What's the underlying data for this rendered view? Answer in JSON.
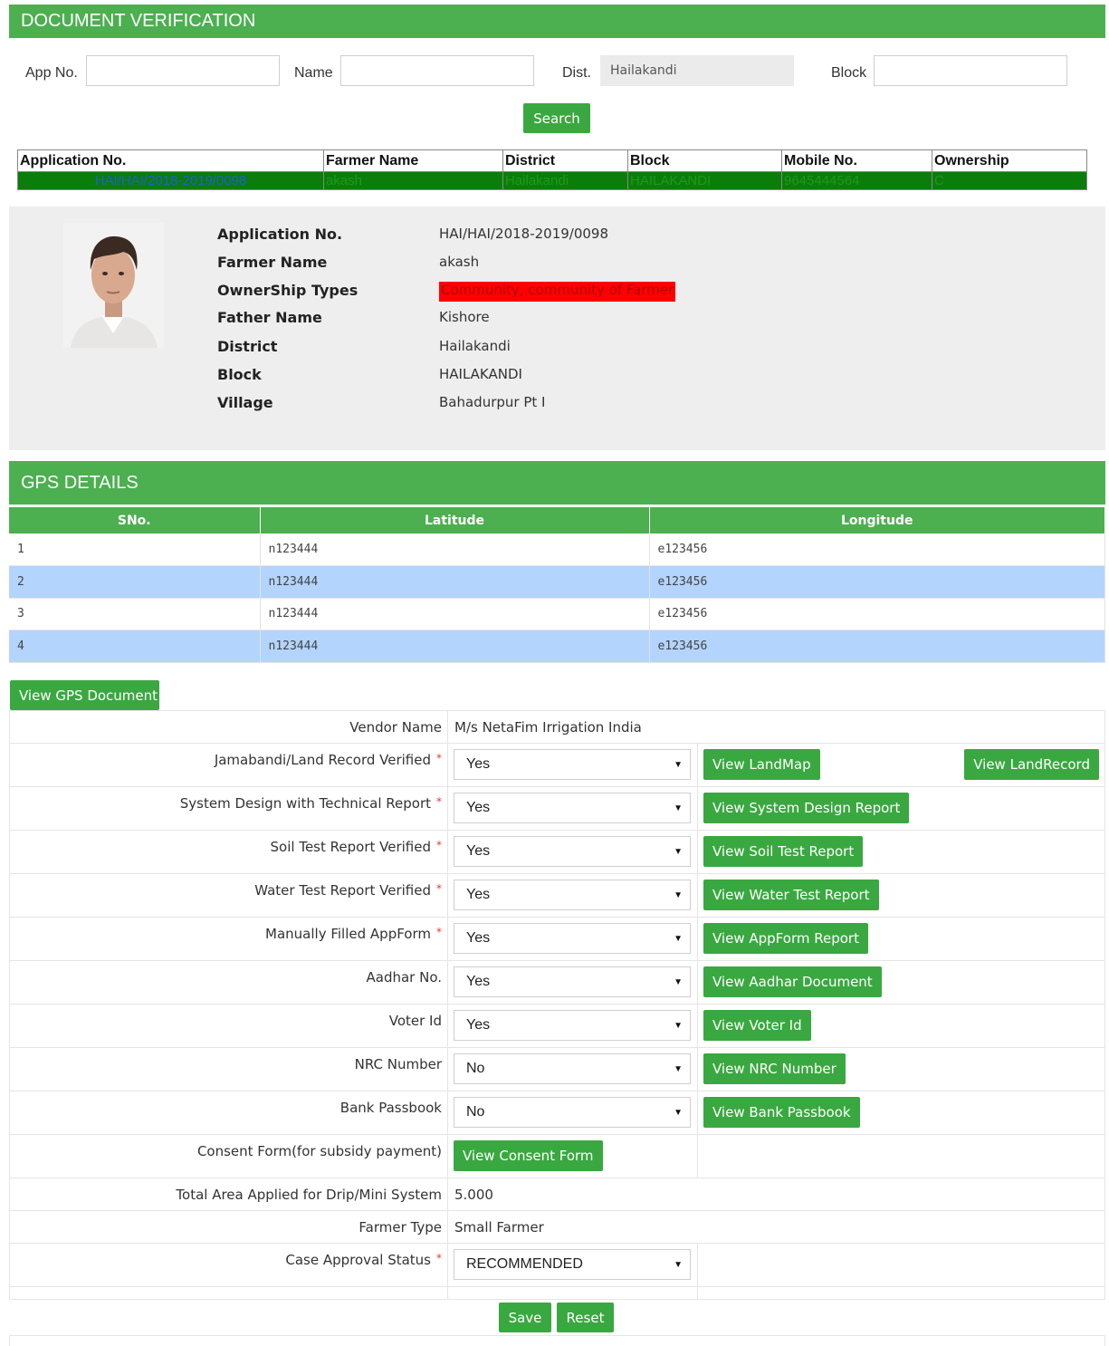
{
  "header": {
    "title": "DOCUMENT VERIFICATION"
  },
  "search": {
    "app_no_label": "App No.",
    "app_no_value": "",
    "name_label": "Name",
    "name_value": "",
    "dist_label": "Dist.",
    "dist_value": "Hailakandi",
    "block_label": "Block",
    "block_value": "",
    "search_button": "Search"
  },
  "results": {
    "headers": [
      "Application No.",
      "Farmer Name",
      "District",
      "Block",
      "Mobile No.",
      "Ownership"
    ],
    "rows": [
      [
        "HAI/HAI/2018-2019/0098",
        "akash",
        "Hailakandi",
        "HAILAKANDI",
        "9645444564",
        "C"
      ]
    ]
  },
  "profile": {
    "labels": {
      "application_no": "Application No.",
      "farmer_name": "Farmer Name",
      "ownership": "OwnerShip Types",
      "father_name": "Father Name",
      "district": "District",
      "block": "Block",
      "village": "Village"
    },
    "values": {
      "application_no": "HAI/HAI/2018-2019/0098",
      "farmer_name": "akash",
      "ownership": "Community, community of Farmer",
      "father_name": "Kishore",
      "district": "Hailakandi",
      "block": "HAILAKANDI",
      "village": "Bahadurpur Pt I"
    }
  },
  "gps": {
    "title": "GPS DETAILS",
    "headers": [
      "SNo.",
      "Latitude",
      "Longitude"
    ],
    "rows": [
      [
        "1",
        "n123444",
        "e123456"
      ],
      [
        "2",
        "n123444",
        "e123456"
      ],
      [
        "3",
        "n123444",
        "e123456"
      ],
      [
        "4",
        "n123444",
        "e123456"
      ]
    ],
    "view_button": "View GPS Document"
  },
  "form": {
    "vendor_label": "Vendor Name",
    "vendor_value": "M/s NetaFim Irrigation India",
    "jamabandi_label": "Jamabandi/Land Record Verified",
    "jamabandi_value": "Yes",
    "view_landmap": "View LandMap",
    "view_landrecord": "View LandRecord",
    "system_label": "System Design with Technical Report",
    "system_value": "Yes",
    "view_system": "View System Design Report",
    "soil_label": "Soil Test Report Verified",
    "soil_value": "Yes",
    "view_soil": "View Soil Test Report",
    "water_label": "Water Test Report Verified",
    "water_value": "Yes",
    "view_water": "View Water Test Report",
    "appform_label": "Manually Filled AppForm",
    "appform_value": "Yes",
    "view_appform": "View AppForm Report",
    "aadhar_label": "Aadhar No.",
    "aadhar_value": "Yes",
    "view_aadhar": "View Aadhar Document",
    "voter_label": "Voter Id",
    "voter_value": "Yes",
    "view_voter": "View Voter Id",
    "nrc_label": "NRC Number",
    "nrc_value": "No",
    "view_nrc": "View NRC Number",
    "bank_label": "Bank Passbook",
    "bank_value": "No",
    "view_bank": "View Bank Passbook",
    "consent_label": "Consent Form(for subsidy payment)",
    "view_consent": "View Consent Form",
    "area_label": "Total Area Applied for Drip/Mini System",
    "area_value": "5.000",
    "farmer_type_label": "Farmer Type",
    "farmer_type_value": "Small Farmer",
    "case_label": "Case Approval Status",
    "case_value": "RECOMMENDED",
    "required_mark": "*"
  },
  "actions": {
    "save": "Save",
    "reset": "Reset"
  },
  "colors": {
    "accent": "#4caf50",
    "button": "#3aa840",
    "row_highlight": "#b3d4fc",
    "result_row": "#0a7d0a",
    "ownership_highlight": "#ff0000"
  }
}
